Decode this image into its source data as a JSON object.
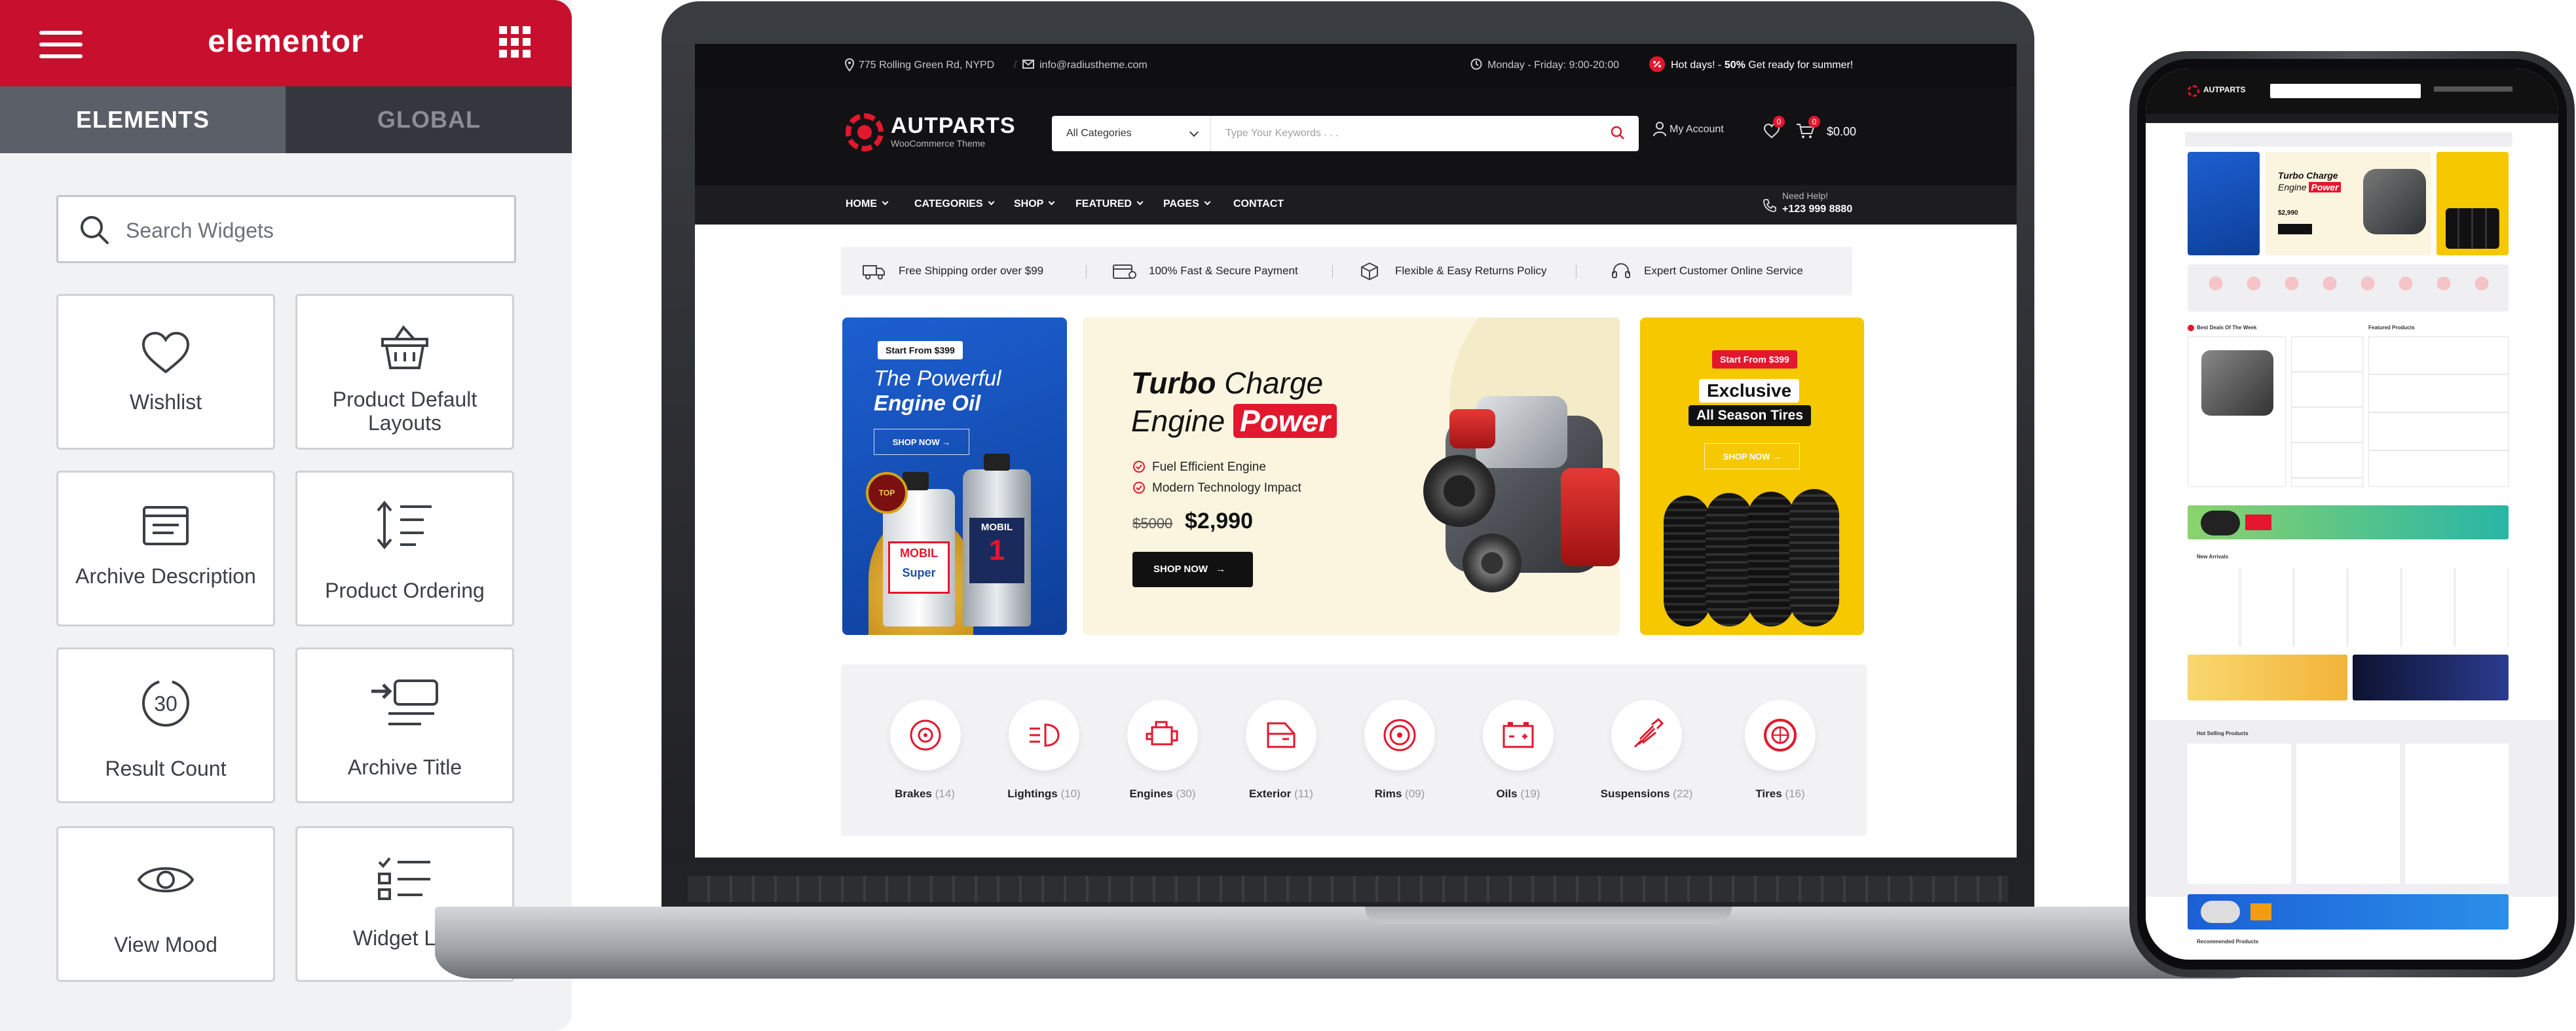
{
  "elementor": {
    "title": "elementor",
    "tabs": [
      "ELEMENTS",
      "GLOBAL"
    ],
    "search_placeholder": "Search Widgets",
    "widgets": [
      "Wishlist",
      "Product Default Layouts",
      "Archive Description",
      "Product Ordering",
      "Result Count",
      "Archive Title",
      "View Mood",
      "Widget List"
    ],
    "accent_color": "#c8102e"
  },
  "site": {
    "topbar": {
      "address": "775 Rolling Green Rd, NYPD",
      "email": "info@radiustheme.com",
      "hours": "Monday - Friday: 9:00-20:00",
      "promo_a": "Hot days! -",
      "promo_b": "50%",
      "promo_c": " Get ready for summer!"
    },
    "logo": {
      "name": "AUTPARTS",
      "tagline": "WooCommerce Theme"
    },
    "search": {
      "category": "All Categories",
      "placeholder": "Type Your Keywords . . ."
    },
    "header": {
      "account": "My Account",
      "wishlist_count": "0",
      "cart_count": "0",
      "cart_total": "$0.00"
    },
    "nav": [
      "HOME",
      "CATEGORIES",
      "SHOP",
      "FEATURED",
      "PAGES",
      "CONTACT"
    ],
    "nav_help": {
      "label": "Need Help!",
      "phone": "+123 999 8880"
    },
    "features": [
      "Free Shipping order over $99",
      "100% Fast & Secure Payment",
      "Flexible & Easy Returns Policy",
      "Expert Customer Online Service"
    ],
    "banners": [
      {
        "tag": "Start From $399",
        "title_a": "The Powerful",
        "title_b": "Engine Oil",
        "button": "SHOP NOW →"
      },
      {
        "title_a": "Turbo",
        "title_b": "Charge",
        "title_c": "Engine",
        "title_d": "Power",
        "features": [
          "Fuel Efficient Engine",
          "Modern Technology Impact"
        ],
        "old_price": "$5000",
        "new_price": "$2,990",
        "button": "SHOP NOW"
      },
      {
        "tag": "Start From $399",
        "title_a": "Exclusive",
        "title_b": "All Season Tires",
        "button": "SHOP NOW →"
      }
    ],
    "categories": [
      {
        "name": "Brakes",
        "count": "(14)"
      },
      {
        "name": "Lightings",
        "count": "(10)"
      },
      {
        "name": "Engines",
        "count": "(30)"
      },
      {
        "name": "Exterior",
        "count": "(11)"
      },
      {
        "name": "Rims",
        "count": "(09)"
      },
      {
        "name": "Oils",
        "count": "(19)"
      },
      {
        "name": "Suspensions",
        "count": "(22)"
      },
      {
        "name": "Tires",
        "count": "(16)"
      }
    ],
    "accent_color": "#e3172d"
  },
  "phone": {
    "sections": [
      "Best Deals Of The Week",
      "Featured Products",
      "New Arrivals",
      "Hot Selling Products",
      "Recommended Products"
    ],
    "banner_texts": [
      "Turbo Charge",
      "Engine",
      "Power",
      "$2,990"
    ]
  }
}
